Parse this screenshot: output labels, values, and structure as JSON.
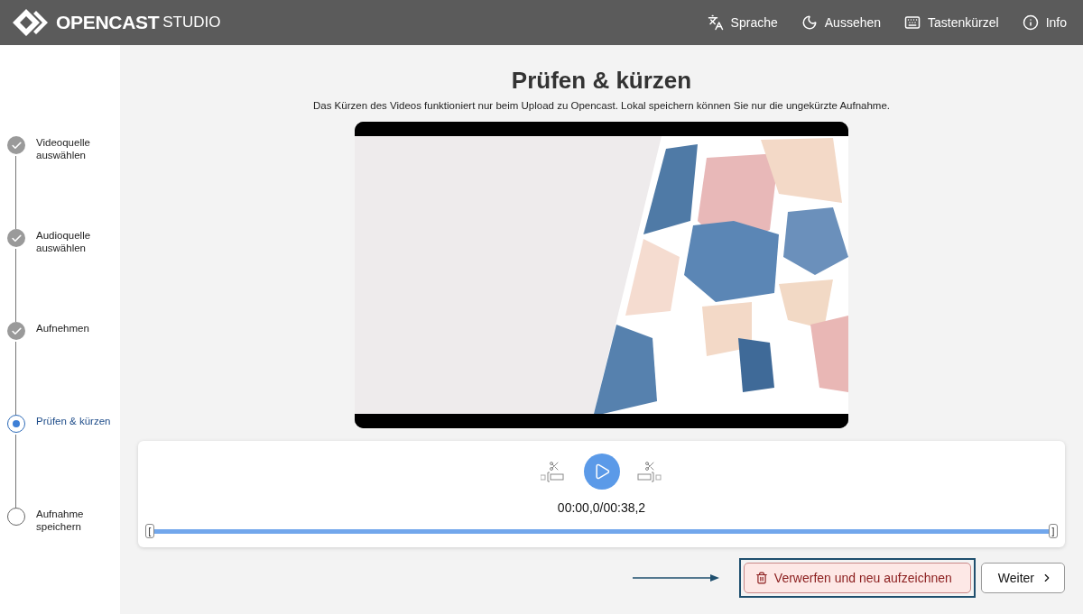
{
  "header": {
    "logo": "OPENCAST",
    "logo_suffix": "STUDIO",
    "menu": [
      {
        "kind": "language",
        "label": "Sprache"
      },
      {
        "kind": "theme",
        "label": "Aussehen"
      },
      {
        "kind": "keyboard",
        "label": "Tastenkürzel"
      },
      {
        "kind": "info",
        "label": "Info"
      }
    ]
  },
  "steps": [
    {
      "label": "Videoquelle auswählen",
      "done": true,
      "selected": false
    },
    {
      "label": "Audioquelle auswählen",
      "done": true,
      "selected": false
    },
    {
      "label": "Aufnehmen",
      "done": true,
      "selected": false
    },
    {
      "label": "Prüfen & kürzen",
      "done": false,
      "selected": true
    },
    {
      "label": "Aufnahme speichern",
      "done": false,
      "selected": false
    }
  ],
  "page": {
    "title": "Prüfen & kürzen",
    "subtitle": "Das Kürzen des Videos funktioniert nur beim Upload zu Opencast. Lokal speichern können Sie nur die ungekürzte Aufnahme."
  },
  "player": {
    "time": "00:00,0/00:38,2",
    "trim_start": "[",
    "trim_end": "]"
  },
  "actions": [
    {
      "kind": "danger",
      "label": "Verwerfen und neu aufzeichnen",
      "highlighted": true
    },
    {
      "kind": "next",
      "label": "Weiter",
      "highlighted": false
    }
  ]
}
